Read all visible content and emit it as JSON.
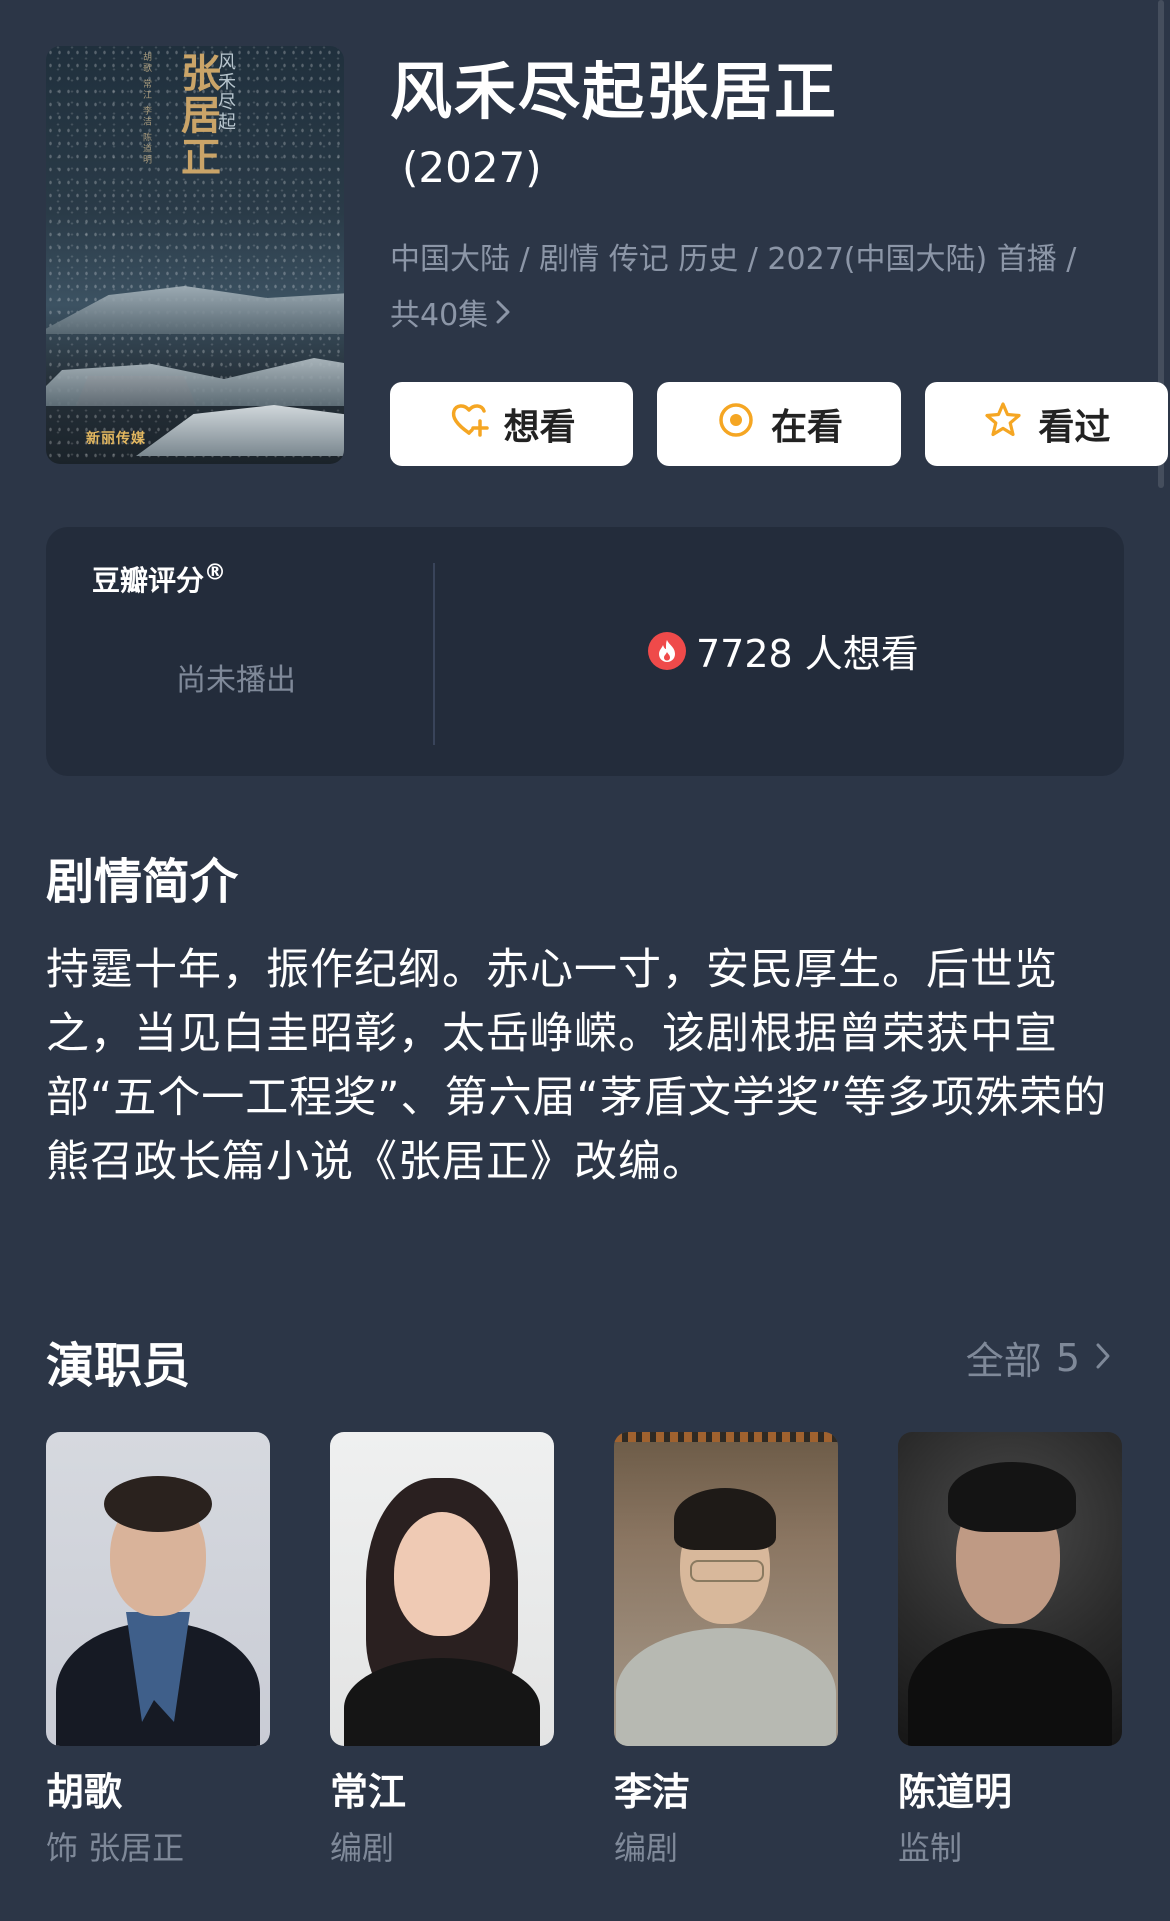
{
  "show": {
    "title": "风禾尽起张居正",
    "year": "(2027)",
    "meta_line": "中国大陆 / 剧情 传记 历史 / 2027(中国大陆) 首播 /",
    "meta_line2": "共40集"
  },
  "poster": {
    "vertical_title": "张居正",
    "vertical_subtitle": "风禾尽起",
    "credit_text": "胡歌 常江 李洁 陈道明",
    "logo_text": "新丽传媒"
  },
  "actions": [
    {
      "label": "想看",
      "icon": "heart-plus-icon",
      "color": "#f5a623"
    },
    {
      "label": "在看",
      "icon": "target-icon",
      "color": "#f5a623"
    },
    {
      "label": "看过",
      "icon": "star-outline-icon",
      "color": "#f5a623"
    }
  ],
  "rating": {
    "label": "豆瓣评分",
    "trademark": "®",
    "status": "尚未播出",
    "wish_count": "7728 人想看",
    "wish_icon": "fire-icon",
    "wish_icon_color": "#ef4a4a"
  },
  "synopsis": {
    "title": "剧情简介",
    "text": "持霆十年，振作纪纲。赤心一寸，安民厚生。后世览之，当见白圭昭彰，太岳峥嵘。该剧根据曾荣获中宣部“五个一工程奖”、第六届“茅盾文学奖”等多项殊荣的熊召政长篇小说《张居正》改编。"
  },
  "cast": {
    "title": "演职员",
    "all_label": "全部",
    "all_count": "5",
    "members": [
      {
        "name": "胡歌",
        "role": "饰 张居正"
      },
      {
        "name": "常江",
        "role": "编剧"
      },
      {
        "name": "李洁",
        "role": "编剧"
      },
      {
        "name": "陈道明",
        "role": "监制"
      }
    ]
  },
  "colors": {
    "background": "#2c3647",
    "card": "#232c3b",
    "accent": "#f5a623",
    "muted_text": "#8c96a7"
  }
}
